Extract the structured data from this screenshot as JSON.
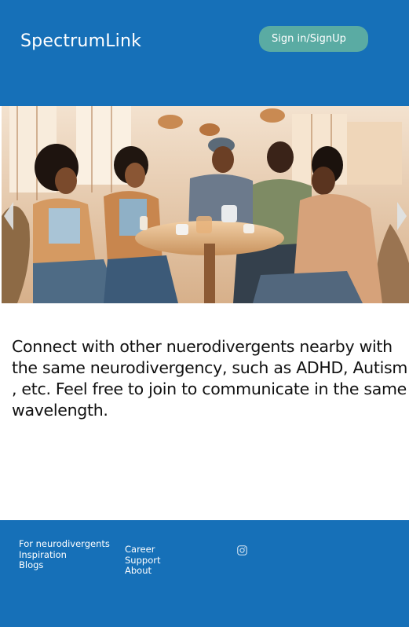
{
  "header": {
    "brand": "SpectrumLink",
    "signin_label": "Sign in/SignUp"
  },
  "hero": {
    "prev_icon": "chevron-left-icon",
    "next_icon": "chevron-right-icon"
  },
  "main": {
    "description": "Connect with other nuerodivergents nearby with the same neurodivergency, such as ADHD, Autism , etc. Feel free to join to communicate in the same wavelength."
  },
  "footer": {
    "col1": [
      "For neurodivergents",
      "Inspiration",
      "Blogs"
    ],
    "col2": [
      "Career",
      "Support",
      "About"
    ],
    "social_icon": "instagram-icon"
  },
  "colors": {
    "brand_blue": "#1670b8",
    "button_teal": "#5aaba3"
  }
}
